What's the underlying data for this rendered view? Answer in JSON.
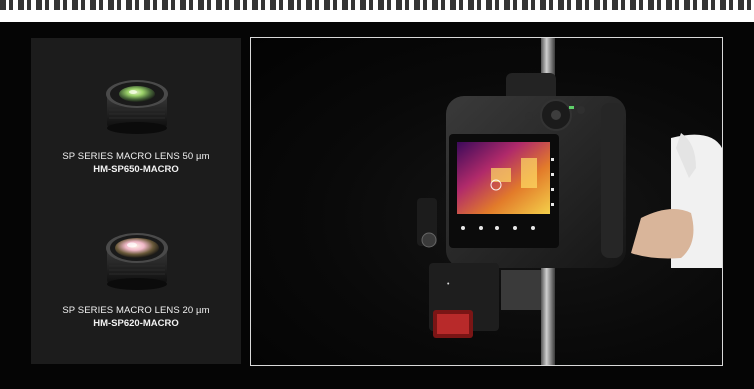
{
  "products": [
    {
      "name": "SP SERIES MACRO LENS 50 µm",
      "model": "HM-SP650-MACRO"
    },
    {
      "name": "SP SERIES MACRO LENS 20 µm",
      "model": "HM-SP620-MACRO"
    }
  ],
  "icons": {
    "lens_1": "camera-lens-icon",
    "lens_2": "camera-lens-icon",
    "camera": "thermal-camera-photo"
  },
  "colors": {
    "background": "#050505",
    "panel": "#1c1c1c",
    "text": "#f2f2f2",
    "accent_lens_1": "#9cd36a",
    "accent_lens_2": "#f0b8c8"
  }
}
